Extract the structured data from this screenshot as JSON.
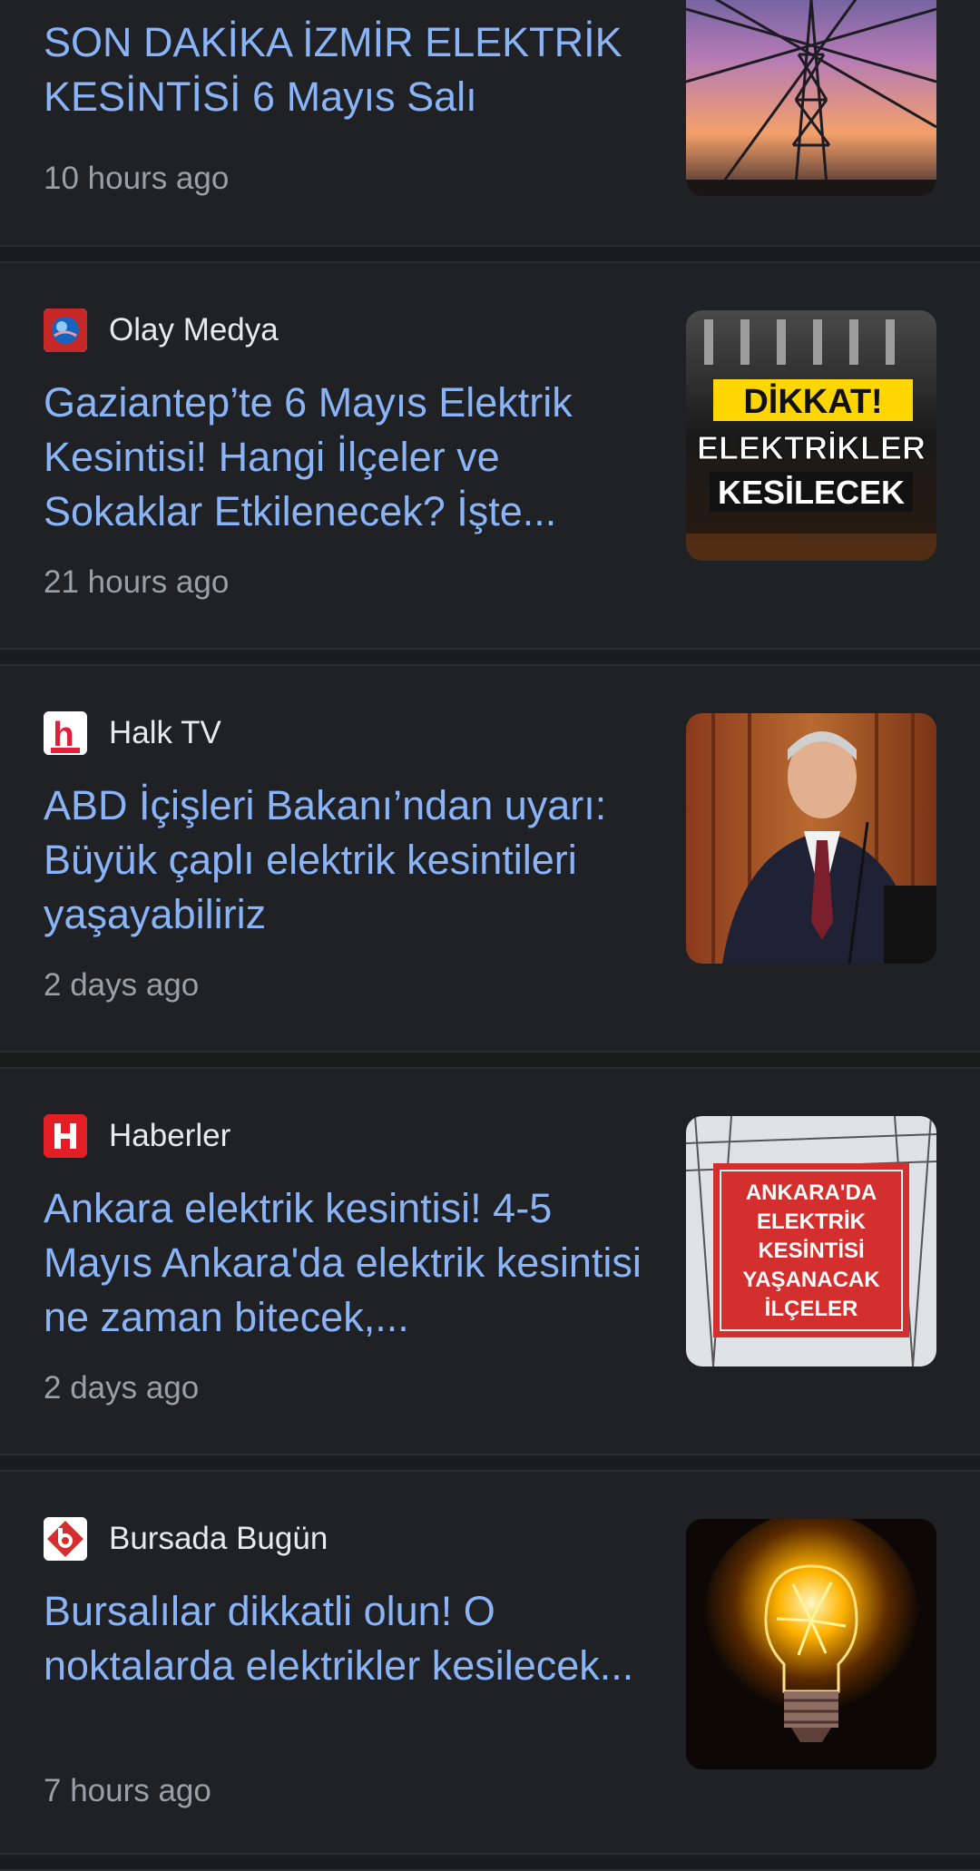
{
  "articles": [
    {
      "source": "",
      "headline": "SON DAKİKA İZMİR ELEKTRİK KESİNTİSİ 6 Mayıs Salı",
      "time": "10 hours ago",
      "thumbnail_icon": "power-pylon-sunset-image"
    },
    {
      "source": "Olay Medya",
      "headline": "Gaziantep’te 6 Mayıs Elektrik Kesintisi! Hangi İlçeler ve Sokaklar Etkilenecek? İşte...",
      "time": "21 hours ago",
      "favicon_icon": "olay-medya-globe-icon",
      "thumbnail_icon": "dikkat-elektrikler-image",
      "thumb_text": {
        "line1": "DİKKAT!",
        "line2": "ELEKTRİKLER",
        "line3": "KESİLECEK"
      }
    },
    {
      "source": "Halk TV",
      "headline": "ABD İçişleri Bakanı’ndan uyarı: Büyük çaplı elektrik kesintileri yaşayabiliriz",
      "time": "2 days ago",
      "favicon_icon": "halk-tv-logo-icon",
      "thumbnail_icon": "speaker-portrait-image"
    },
    {
      "source": "Haberler",
      "headline": "Ankara elektrik kesintisi! 4-5 Mayıs Ankara'da elektrik kesintisi ne zaman bitecek,...",
      "time": "2 days ago",
      "favicon_icon": "haberler-logo-icon",
      "thumbnail_icon": "ankara-kesinti-image",
      "thumb_text": {
        "line1": "ANKARA'DA",
        "line2": "ELEKTRİK",
        "line3": "KESİNTİSİ",
        "line4": "YAŞANACAK",
        "line5": "İLÇELER"
      }
    },
    {
      "source": "Bursada Bugün",
      "headline": "Bursalılar dikkatli olun! O noktalarda elektrikler kesilecek...",
      "time": "7 hours ago",
      "favicon_icon": "bursada-bugun-logo-icon",
      "thumbnail_icon": "glowing-lightbulb-image"
    }
  ],
  "colors": {
    "background": "#202124",
    "headline": "#8ab4f8",
    "source": "#e8eaed",
    "time": "#9aa0a6",
    "separator": "#1b1c1e"
  }
}
